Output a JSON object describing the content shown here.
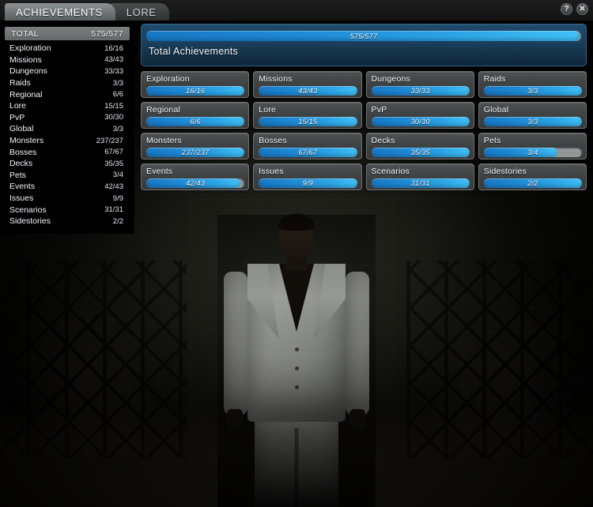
{
  "window": {
    "help_icon": "?",
    "close_icon": "✕"
  },
  "tabs": [
    {
      "label": "ACHIEVEMENTS",
      "active": true
    },
    {
      "label": "LORE",
      "active": false
    }
  ],
  "sidebar": {
    "total": {
      "label": "TOTAL",
      "value": "575/577"
    },
    "items": [
      {
        "label": "Exploration",
        "value": "16/16"
      },
      {
        "label": "Missions",
        "value": "43/43"
      },
      {
        "label": "Dungeons",
        "value": "33/33"
      },
      {
        "label": "Raids",
        "value": "3/3"
      },
      {
        "label": "Regional",
        "value": "6/6"
      },
      {
        "label": "Lore",
        "value": "15/15"
      },
      {
        "label": "PvP",
        "value": "30/30"
      },
      {
        "label": "Global",
        "value": "3/3"
      },
      {
        "label": "Monsters",
        "value": "237/237"
      },
      {
        "label": "Bosses",
        "value": "67/67"
      },
      {
        "label": "Decks",
        "value": "35/35"
      },
      {
        "label": "Pets",
        "value": "3/4"
      },
      {
        "label": "Events",
        "value": "42/43"
      },
      {
        "label": "Issues",
        "value": "9/9"
      },
      {
        "label": "Scenarios",
        "value": "31/31"
      },
      {
        "label": "Sidestories",
        "value": "2/2"
      }
    ]
  },
  "main": {
    "total_card": {
      "title": "Total Achievements",
      "bar_text": "575/577",
      "percent": 99.65
    },
    "tiles": [
      {
        "label": "Exploration",
        "bar_text": "16/16",
        "percent": 100
      },
      {
        "label": "Missions",
        "bar_text": "43/43",
        "percent": 100
      },
      {
        "label": "Dungeons",
        "bar_text": "33/33",
        "percent": 100
      },
      {
        "label": "Raids",
        "bar_text": "3/3",
        "percent": 100
      },
      {
        "label": "Regional",
        "bar_text": "6/6",
        "percent": 100
      },
      {
        "label": "Lore",
        "bar_text": "15/15",
        "percent": 100
      },
      {
        "label": "PvP",
        "bar_text": "30/30",
        "percent": 100
      },
      {
        "label": "Global",
        "bar_text": "3/3",
        "percent": 100
      },
      {
        "label": "Monsters",
        "bar_text": "237/237",
        "percent": 100
      },
      {
        "label": "Bosses",
        "bar_text": "67/67",
        "percent": 100
      },
      {
        "label": "Decks",
        "bar_text": "35/35",
        "percent": 100
      },
      {
        "label": "Pets",
        "bar_text": "3/4",
        "percent": 75
      },
      {
        "label": "Events",
        "bar_text": "42/43",
        "percent": 96
      },
      {
        "label": "Issues",
        "bar_text": "9/9",
        "percent": 100
      },
      {
        "label": "Scenarios",
        "bar_text": "31/31",
        "percent": 100
      },
      {
        "label": "Sidestories",
        "bar_text": "2/2",
        "percent": 100
      }
    ]
  },
  "colors": {
    "bar_fill_start": "#1878c4",
    "bar_fill_end": "#3fc0f5",
    "bar_track": "#9b9e9f",
    "panel_blue": "#1b4261",
    "tile_gray": "#3f4243",
    "tab_active": "#6e7375"
  }
}
